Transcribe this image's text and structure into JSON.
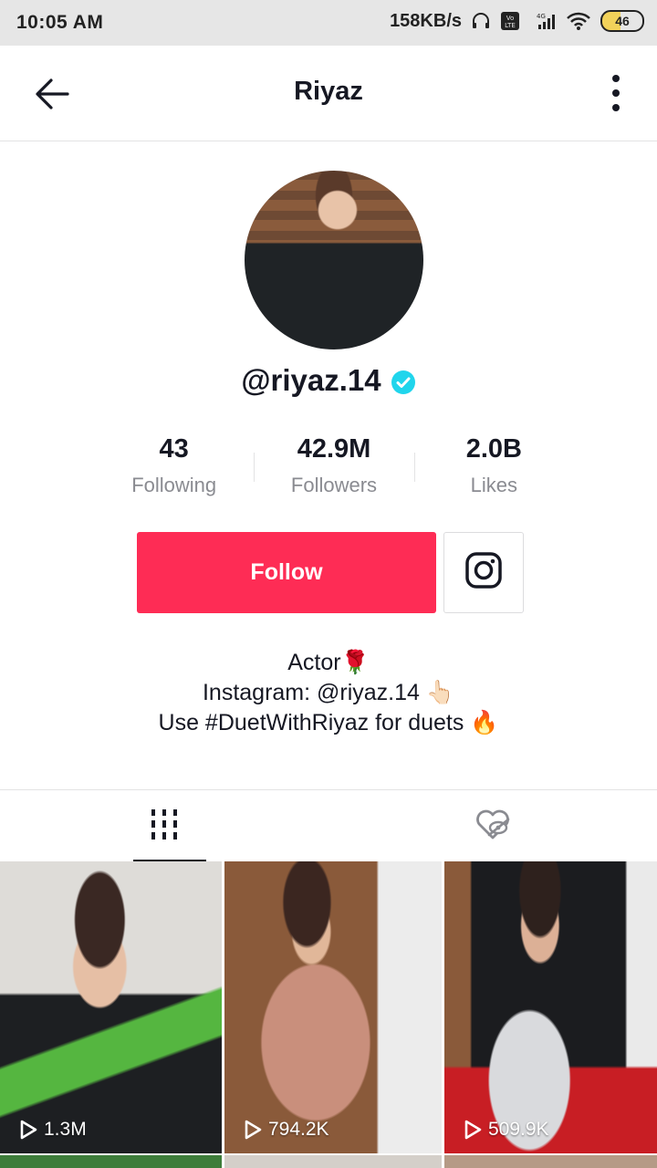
{
  "status_bar": {
    "time": "10:05 AM",
    "net_speed": "158KB/s",
    "battery": "46"
  },
  "header": {
    "title": "Riyaz"
  },
  "profile": {
    "handle": "@riyaz.14",
    "stats": [
      {
        "value": "43",
        "label": "Following"
      },
      {
        "value": "42.9M",
        "label": "Followers"
      },
      {
        "value": "2.0B",
        "label": "Likes"
      }
    ],
    "follow_label": "Follow",
    "bio": [
      "Actor🌹",
      "Instagram: @riyaz.14 👆🏻",
      "Use #DuetWithRiyaz for duets 🔥"
    ]
  },
  "tabs": [
    {
      "icon": "grid-icon",
      "active": true
    },
    {
      "icon": "liked-hidden-icon",
      "active": false
    }
  ],
  "videos": [
    {
      "views": "1.3M"
    },
    {
      "views": "794.2K"
    },
    {
      "views": "509.9K"
    }
  ],
  "colors": {
    "accent": "#fe2c55",
    "text": "#161823",
    "muted": "#8a8b91",
    "verified": "#20d5ec"
  }
}
